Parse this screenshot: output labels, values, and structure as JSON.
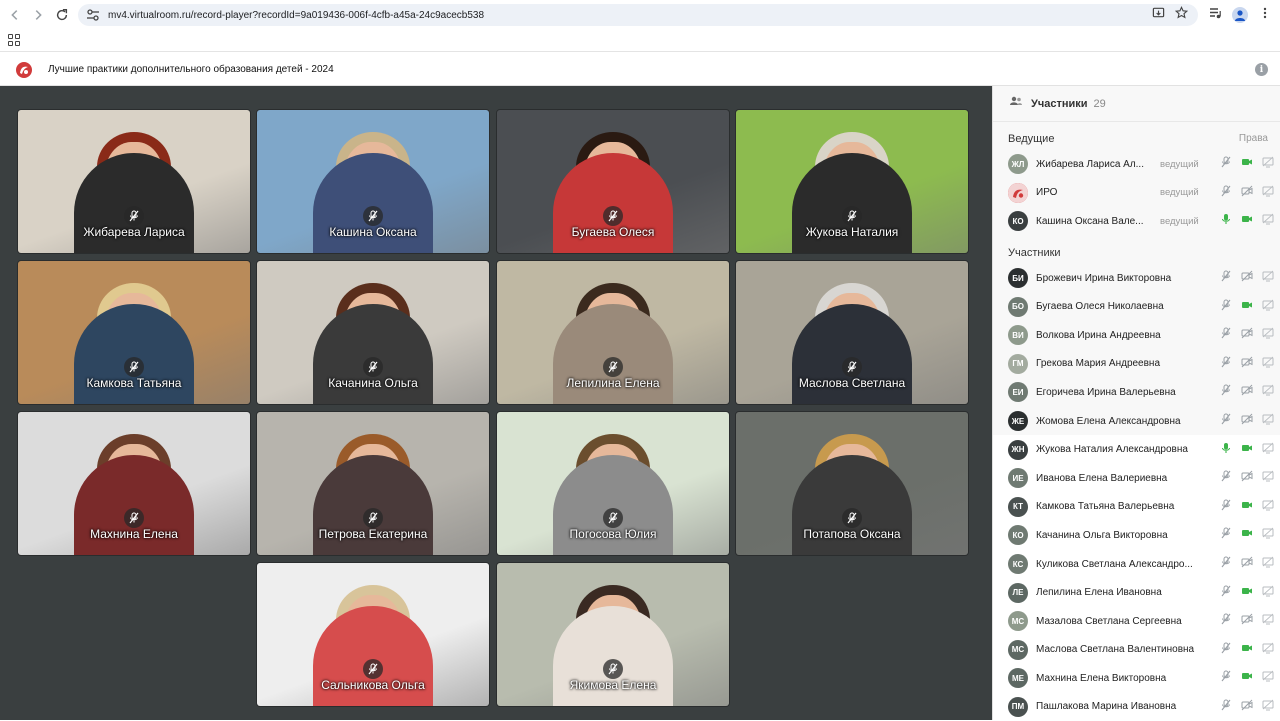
{
  "browser": {
    "url": "mv4.virtualroom.ru/record-player?recordId=9a019436-006f-4cfb-a45a-24c9acecb538"
  },
  "app": {
    "title": "Лучшие практики дополнительного образования детей - 2024",
    "info_icon": "i"
  },
  "participants_panel": {
    "title": "Участники",
    "count": "29",
    "hosts_heading": "Ведущие",
    "rights_label": "Права",
    "participants_heading": "Участники",
    "hosts": [
      {
        "initials": "ЖЛ",
        "name": "Жибарева Лариса Ал...",
        "role": "ведущий",
        "avatar_color": "#8e9a8c",
        "mic": "muted",
        "cam": "on"
      },
      {
        "initials": "",
        "name": "ИРО",
        "role": "ведущий",
        "avatar_color": "#d13b3b",
        "mic": "muted",
        "cam": "off"
      },
      {
        "initials": "КО",
        "name": "Кашина Оксана Вале...",
        "role": "ведущий",
        "avatar_color": "#3a3f40",
        "mic": "on",
        "cam": "on"
      }
    ],
    "participants": [
      {
        "initials": "БИ",
        "name": "Брожевич Ирина Викторовна",
        "avatar_color": "#2b2f30",
        "mic": "muted",
        "cam": "off"
      },
      {
        "initials": "БО",
        "name": "Бугаева Олеся Николаевна",
        "avatar_color": "#6f7a72",
        "mic": "muted",
        "cam": "on"
      },
      {
        "initials": "ВИ",
        "name": "Волкова Ирина Андреевна",
        "avatar_color": "#8e9a8c",
        "mic": "muted",
        "cam": "off"
      },
      {
        "initials": "ГМ",
        "name": "Грекова Мария Андреевна",
        "avatar_color": "#a3ab9f",
        "mic": "muted",
        "cam": "off"
      },
      {
        "initials": "ЕИ",
        "name": "Егоричева Ирина Валерьевна",
        "avatar_color": "#6f7a72",
        "mic": "muted",
        "cam": "off"
      },
      {
        "initials": "ЖЕ",
        "name": "Жомова Елена Александровна",
        "avatar_color": "#2b2f30",
        "mic": "muted",
        "cam": "off"
      },
      {
        "initials": "ЖН",
        "name": "Жукова Наталия Александровна",
        "avatar_color": "#3a3f40",
        "mic": "on",
        "cam": "on"
      },
      {
        "initials": "ИЕ",
        "name": "Иванова Елена Валериевна",
        "avatar_color": "#6f7a72",
        "mic": "muted",
        "cam": "off"
      },
      {
        "initials": "КТ",
        "name": "Камкова Татьяна Валерьевна",
        "avatar_color": "#4a5150",
        "mic": "muted",
        "cam": "on"
      },
      {
        "initials": "КО",
        "name": "Качанина Ольга Викторовна",
        "avatar_color": "#6f7a72",
        "mic": "muted",
        "cam": "on"
      },
      {
        "initials": "КС",
        "name": "Куликова Светлана Александро...",
        "avatar_color": "#6f7a72",
        "mic": "muted",
        "cam": "off"
      },
      {
        "initials": "ЛЕ",
        "name": "Лепилина Елена Ивановна",
        "avatar_color": "#5d6863",
        "mic": "muted",
        "cam": "on"
      },
      {
        "initials": "МС",
        "name": "Мазалова Светлана Сергеевна",
        "avatar_color": "#8e9a8c",
        "mic": "muted",
        "cam": "off"
      },
      {
        "initials": "МС",
        "name": "Маслова Светлана Валентиновна",
        "avatar_color": "#5d6863",
        "mic": "muted",
        "cam": "on"
      },
      {
        "initials": "МЕ",
        "name": "Махнина Елена Викторовна",
        "avatar_color": "#5d6863",
        "mic": "muted",
        "cam": "on"
      },
      {
        "initials": "ПМ",
        "name": "Пашлакова Марина Ивановна",
        "avatar_color": "#4a5150",
        "mic": "muted",
        "cam": "off"
      }
    ]
  },
  "tiles": [
    {
      "name": "Жибарева Лариса",
      "bg": "#d9d2c6",
      "hair": "#8a2a18",
      "shirt": "#2b2b2b"
    },
    {
      "name": "Кашина Оксана",
      "bg": "#7fa7c9",
      "hair": "#c9b48a",
      "shirt": "#3e4f78"
    },
    {
      "name": "Бугаева Олеся",
      "bg": "#4b4e52",
      "hair": "#2a1a12",
      "shirt": "#c63838"
    },
    {
      "name": "Жукова Наталия",
      "bg": "#8dbb4f",
      "hair": "#d9d4c7",
      "shirt": "#2b2b2b"
    },
    {
      "name": "Камкова Татьяна",
      "bg": "#b98b5a",
      "hair": "#e0c98f",
      "shirt": "#2e4660"
    },
    {
      "name": "Качанина Ольга",
      "bg": "#cfcac1",
      "hair": "#5a2e1c",
      "shirt": "#3a3a3a"
    },
    {
      "name": "Лепилина Елена",
      "bg": "#bfb8a3",
      "hair": "#3b2a1e",
      "shirt": "#9a8a7a"
    },
    {
      "name": "Маслова Светлана",
      "bg": "#a9a497",
      "hair": "#d8d6d2",
      "shirt": "#2c3038"
    },
    {
      "name": "Махнина Елена",
      "bg": "#dcdcdc",
      "hair": "#6b3e2a",
      "shirt": "#7a2a2a"
    },
    {
      "name": "Петрова Екатерина",
      "bg": "#b7b4ad",
      "hair": "#9a5b2a",
      "shirt": "#4a3a3a"
    },
    {
      "name": "Погосова Юлия",
      "bg": "#d9e3d2",
      "hair": "#6b4e2e",
      "shirt": "#8c8c8c"
    },
    {
      "name": "Потапова Оксана",
      "bg": "#6b6f6a",
      "hair": "#c79a4e",
      "shirt": "#3a3a3a"
    },
    {
      "name": "Сальникова Ольга",
      "bg": "#eeeeee",
      "hair": "#d8c49a",
      "shirt": "#d64d4d"
    },
    {
      "name": "Якимова Елена",
      "bg": "#b8bcae",
      "hair": "#3a2a22",
      "shirt": "#e8e0d8"
    }
  ],
  "colors": {
    "stage": "#3a3f40",
    "mic_on": "#3cb44a",
    "cam_on": "#3cb44a",
    "muted_icon": "#9aa0a6"
  }
}
